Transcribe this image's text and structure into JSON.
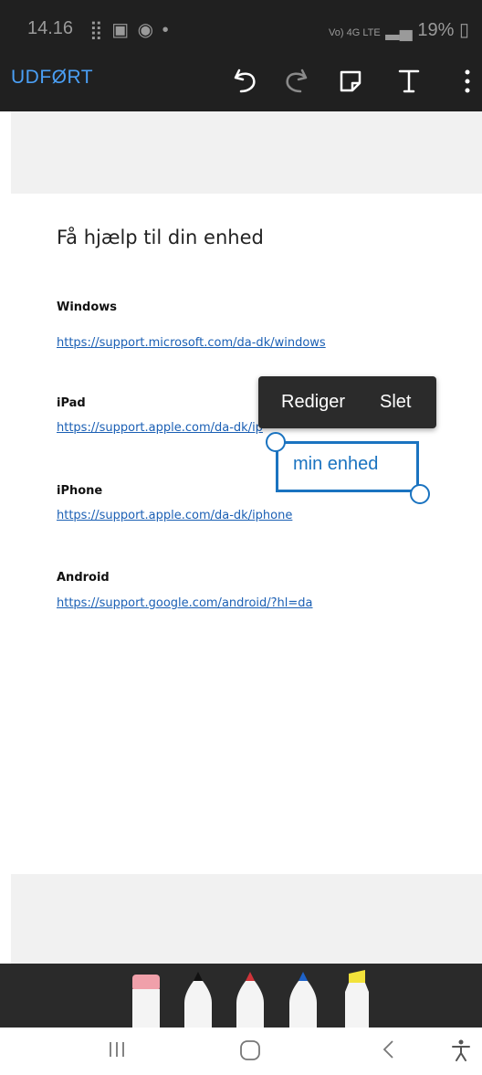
{
  "status_bar": {
    "time": "14.16",
    "notification_icons": "⣿ ▣ ◉ •",
    "network": "Vo) 4G LTE",
    "battery": "19%"
  },
  "toolbar": {
    "done_label": "UDFØRT",
    "accent_color": "#4a9ff5",
    "icons": [
      "undo-icon",
      "redo-icon",
      "sticky-note-icon",
      "text-icon",
      "more-vertical-icon"
    ]
  },
  "document": {
    "title": "Få hjælp til din enhed",
    "sections": [
      {
        "heading": "Windows",
        "link": "https://support.microsoft.com/da-dk/windows"
      },
      {
        "heading": "iPad",
        "link": "https://support.apple.com/da-dk/ip"
      },
      {
        "heading": "iPhone",
        "link": "https://support.apple.com/da-dk/iphone"
      },
      {
        "heading": "Android",
        "link": "https://support.google.com/android/?hl=da"
      }
    ],
    "link_color": "#1a5fb4"
  },
  "context_menu": {
    "edit_label": "Rediger",
    "delete_label": "Slet"
  },
  "annotation": {
    "text": "min enhed",
    "color": "#1a73c0"
  },
  "pen_tray": {
    "tools": [
      {
        "name": "eraser",
        "color": "#f0a0aa"
      },
      {
        "name": "pen-black",
        "color": "#111111"
      },
      {
        "name": "pen-red",
        "color": "#d0343a"
      },
      {
        "name": "pen-blue",
        "color": "#1e62c8"
      },
      {
        "name": "highlighter-yellow",
        "color": "#f2e23a"
      }
    ]
  },
  "nav_bar": {
    "icons": [
      "recent-apps-icon",
      "home-icon",
      "back-icon",
      "accessibility-icon"
    ]
  }
}
